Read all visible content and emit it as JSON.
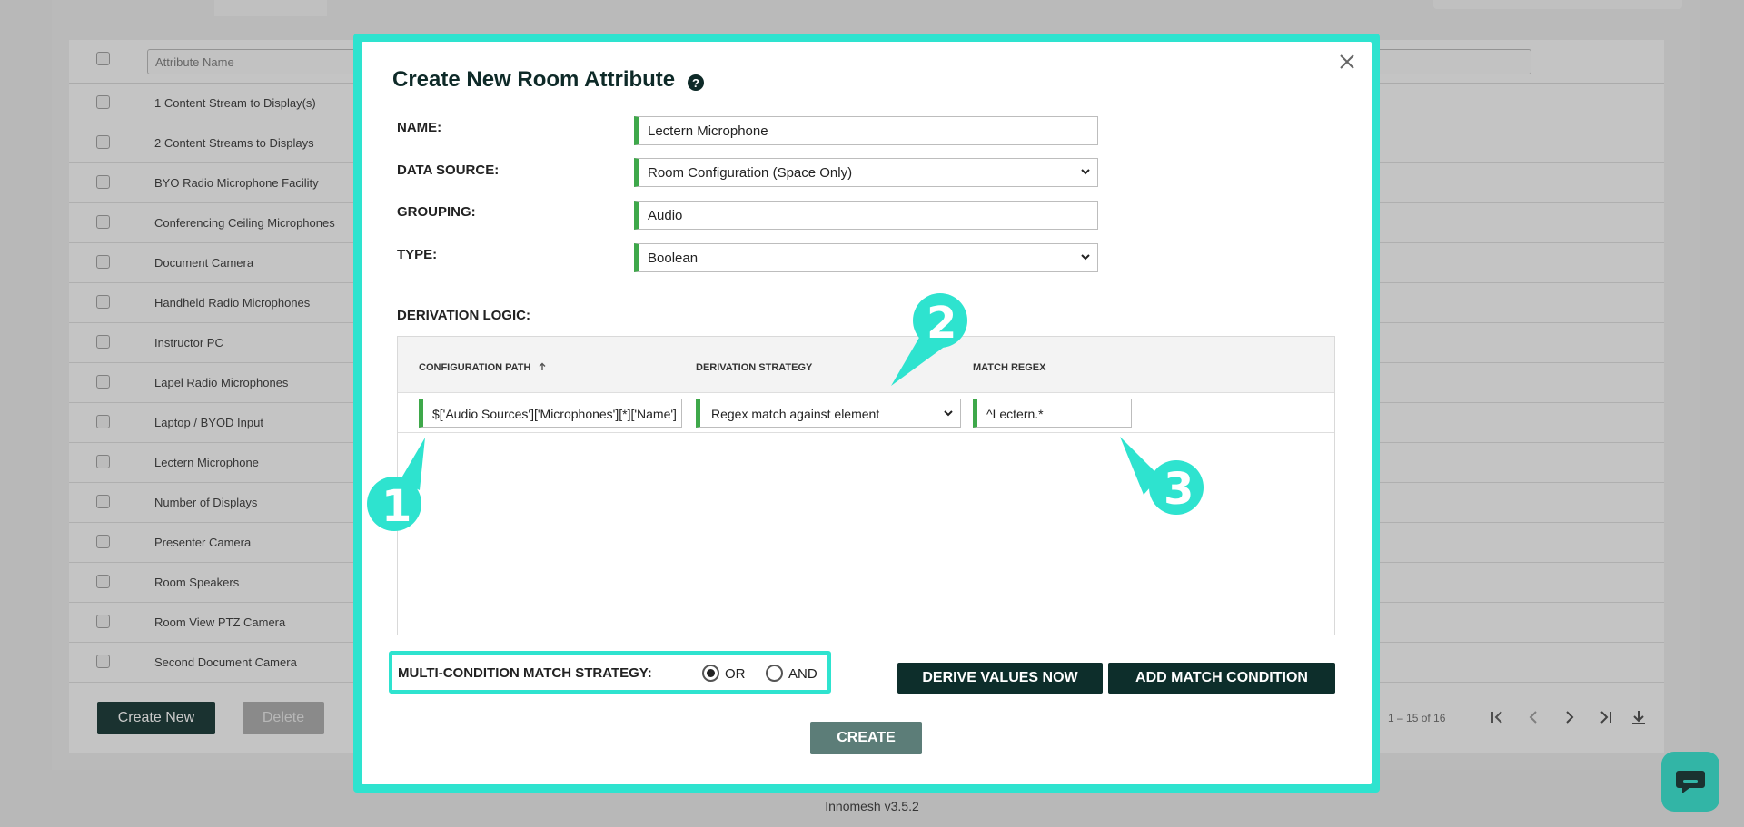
{
  "background": {
    "filter_placeholder": "Attribute Name",
    "rows": [
      "1 Content Stream to Display(s)",
      "2 Content Streams to Displays",
      "BYO Radio Microphone Facility",
      "Conferencing Ceiling Microphones",
      "Document Camera",
      "Handheld Radio Microphones",
      "Instructor PC",
      "Lapel Radio Microphones",
      "Laptop / BYOD Input",
      "Lectern Microphone",
      "Number of Displays",
      "Presenter Camera",
      "Room Speakers",
      "Room View PTZ Camera",
      "Second Document Camera"
    ],
    "create_new_label": "Create New",
    "delete_label": "Delete",
    "pager_text": "1 – 15 of 16",
    "pager_icons": [
      "first-page-icon",
      "prev-page-icon",
      "next-page-icon",
      "last-page-icon",
      "download-icon"
    ],
    "version": "Innomesh v3.5.2"
  },
  "modal": {
    "title": "Create New Room Attribute",
    "help_icon": "?",
    "fields": {
      "name_label": "NAME:",
      "name_value": "Lectern Microphone",
      "data_source_label": "DATA SOURCE:",
      "data_source_value": "Room Configuration (Space Only)",
      "grouping_label": "GROUPING:",
      "grouping_value": "Audio",
      "type_label": "TYPE:",
      "type_value": "Boolean"
    },
    "derivation": {
      "label": "DERIVATION LOGIC:",
      "columns": [
        "CONFIGURATION PATH",
        "DERIVATION STRATEGY",
        "MATCH REGEX"
      ],
      "row": {
        "path": "$['Audio Sources']['Microphones'][*]['Name']",
        "strategy": "Regex match against element",
        "regex": "^Lectern.*"
      }
    },
    "strategy": {
      "label": "MULTI-CONDITION MATCH STRATEGY:",
      "options": [
        "OR",
        "AND"
      ],
      "selected": "OR"
    },
    "derive_button": "DERIVE VALUES NOW",
    "add_condition_button": "ADD MATCH CONDITION",
    "create_button": "CREATE"
  },
  "callouts": [
    "1",
    "2",
    "3"
  ],
  "colors": {
    "accent_teal": "#2ee3cf",
    "dark_green": "#0d2e2b",
    "field_green": "#3ea84a",
    "create_disabled": "#5c7d78"
  }
}
